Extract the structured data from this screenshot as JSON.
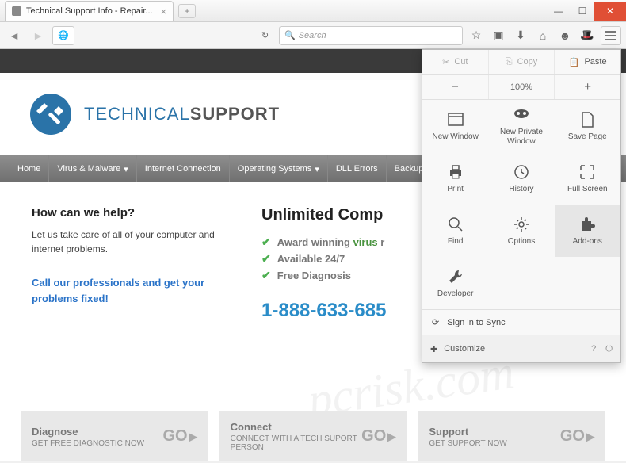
{
  "window": {
    "tab_title": "Technical Support Info - Repair..."
  },
  "toolbar": {
    "search_placeholder": "Search"
  },
  "menu": {
    "cut": "Cut",
    "copy": "Copy",
    "paste": "Paste",
    "zoom": "100%",
    "items": [
      {
        "label": "New Window"
      },
      {
        "label": "New Private Window"
      },
      {
        "label": "Save Page"
      },
      {
        "label": "Print"
      },
      {
        "label": "History"
      },
      {
        "label": "Full Screen"
      },
      {
        "label": "Find"
      },
      {
        "label": "Options"
      },
      {
        "label": "Add-ons"
      },
      {
        "label": "Developer"
      }
    ],
    "sign_in": "Sign in to Sync",
    "customize": "Customize"
  },
  "page": {
    "logo": {
      "a": "TECHNICAL",
      "b": "SUPPORT"
    },
    "nav": [
      "Home",
      "Virus & Malware",
      "Internet Connection",
      "Operating Systems",
      "DLL Errors",
      "Backup & R"
    ],
    "help": {
      "title": "How can we help?",
      "body": "Let us take care of all of your computer and internet problems.",
      "cta": "Call our professionals and get your problems fixed!"
    },
    "main": {
      "title": "Unlimited Comp",
      "feat1a": "Award winning ",
      "feat1b": "virus",
      "feat1c": " r",
      "feat2": "Available 24/7",
      "feat3": "Free Diagnosis",
      "phone": "1-888-633-685"
    },
    "boxes": [
      {
        "t": "Diagnose",
        "s": "GET FREE DIAGNOSTIC NOW",
        "go": "GO"
      },
      {
        "t": "Connect",
        "s": "CONNECT WITH A TECH SUPORT PERSON",
        "go": "GO"
      },
      {
        "t": "Support",
        "s": "GET SUPPORT NOW",
        "go": "GO"
      }
    ]
  }
}
